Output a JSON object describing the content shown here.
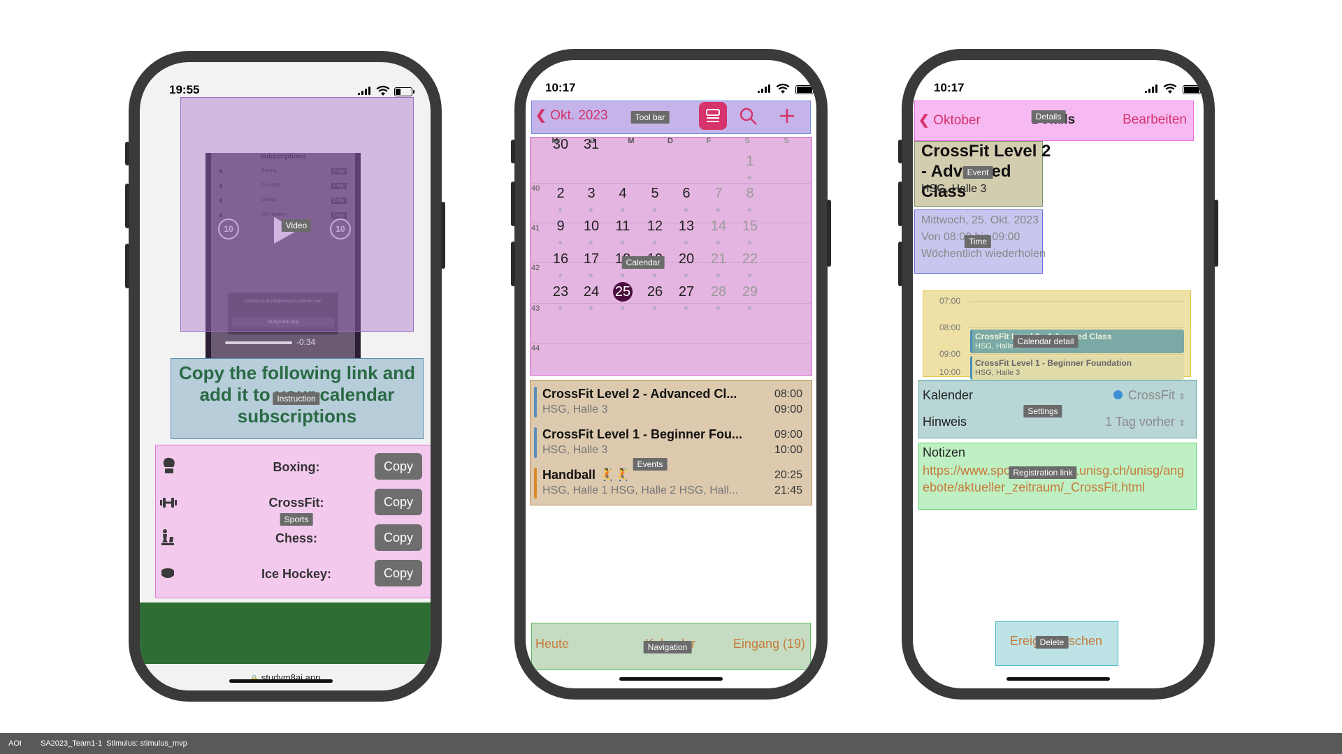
{
  "colors": {
    "accent_pink": "#d6336c",
    "accent_orange": "#c67b3a",
    "crossfit_dot": "#3b8fd4",
    "green_bar": "#2e6e34"
  },
  "phone1": {
    "time": "19:55",
    "video": {
      "heading": "subscriptions",
      "rows": [
        "Boxing:",
        "CrossFit:",
        "Chess:",
        "Ice Hockey:"
      ],
      "copy": "Copy",
      "skip_back": "10",
      "skip_fwd": "10",
      "contact": "Contact us at info@unisport-stcenter.com",
      "url_small": "studym8ai.app",
      "remaining": "-0:34"
    },
    "instruction": "Copy the following link and add it to your calendar subscriptions",
    "sports": [
      {
        "label": "Boxing:",
        "icon": "boxing-glove-icon"
      },
      {
        "label": "CrossFit:",
        "icon": "dumbbell-icon"
      },
      {
        "label": "Chess:",
        "icon": "chess-icon"
      },
      {
        "label": "Ice Hockey:",
        "icon": "hockey-puck-icon"
      }
    ],
    "copy_label": "Copy",
    "url": "studym8ai.app"
  },
  "phone2": {
    "time": "10:17",
    "month": "Okt. 2023",
    "weekdays": [
      "M",
      "D",
      "M",
      "D",
      "F",
      "S",
      "S"
    ],
    "week_numbers": [
      "40",
      "41",
      "42",
      "43",
      "44"
    ],
    "selected_day": "25",
    "events": [
      {
        "title": "CrossFit Level 2 - Advanced Cl...",
        "location": "HSG, Halle 3",
        "start": "08:00",
        "end": "09:00",
        "color": "#5a8fb8"
      },
      {
        "title": "CrossFit Level 1 - Beginner Fou...",
        "location": "HSG, Halle 3",
        "start": "09:00",
        "end": "10:00",
        "color": "#5a8fb8"
      },
      {
        "title": "Handball 🤾🤾",
        "location": "HSG, Halle 1 HSG, Halle 2 HSG, Hall...",
        "start": "20:25",
        "end": "21:45",
        "color": "#d98a2b"
      }
    ],
    "nav": {
      "today": "Heute",
      "calendar": "Kalender",
      "inbox": "Eingang (19)"
    }
  },
  "phone3": {
    "time": "10:17",
    "back": "Oktober",
    "title": "Details",
    "edit": "Bearbeiten",
    "event_title": "CrossFit Level 2 - Advanced Class",
    "event_location": "HSG, Halle 3",
    "date": "Mittwoch, 25. Okt. 2023",
    "time_range": "Von 08:00 bis 09:00",
    "repeat": "Wöchentlich wiederholen",
    "timeline": {
      "hours": [
        "07:00",
        "08:00",
        "09:00",
        "10:00"
      ],
      "event1_title": "CrossFit Level 2 - Advanced Class",
      "event1_loc": "HSG, Halle 3",
      "event2_title": "CrossFit Level 1 - Beginner Foundation",
      "event2_loc": "HSG, Halle 3"
    },
    "calendar_label": "Kalender",
    "calendar_value": "CrossFit",
    "alert_label": "Hinweis",
    "alert_value": "1 Tag vorher",
    "notes_label": "Notizen",
    "notes_link": "https://www.sportprogramm.unisg.ch/unisg/angebote/aktueller_zeitraum/_CrossFit.html",
    "delete": "Ereignis löschen"
  },
  "aoi_labels": {
    "video": "Video",
    "instruction": "Instruction",
    "sports": "Sports",
    "toolbar": "Tool bar",
    "calendar": "Calendar",
    "events": "Events",
    "navigation": "Navigation",
    "details": "Details",
    "event": "Event",
    "time": "Time",
    "calendar_detail": "Calendar detail",
    "settings": "Settings",
    "registration_link": "Registration link",
    "delete": "Delete"
  },
  "footer": {
    "aoi": "AOI",
    "stimulus": "SA2023_Team1-1  Stimulus: stimulus_mvp"
  }
}
